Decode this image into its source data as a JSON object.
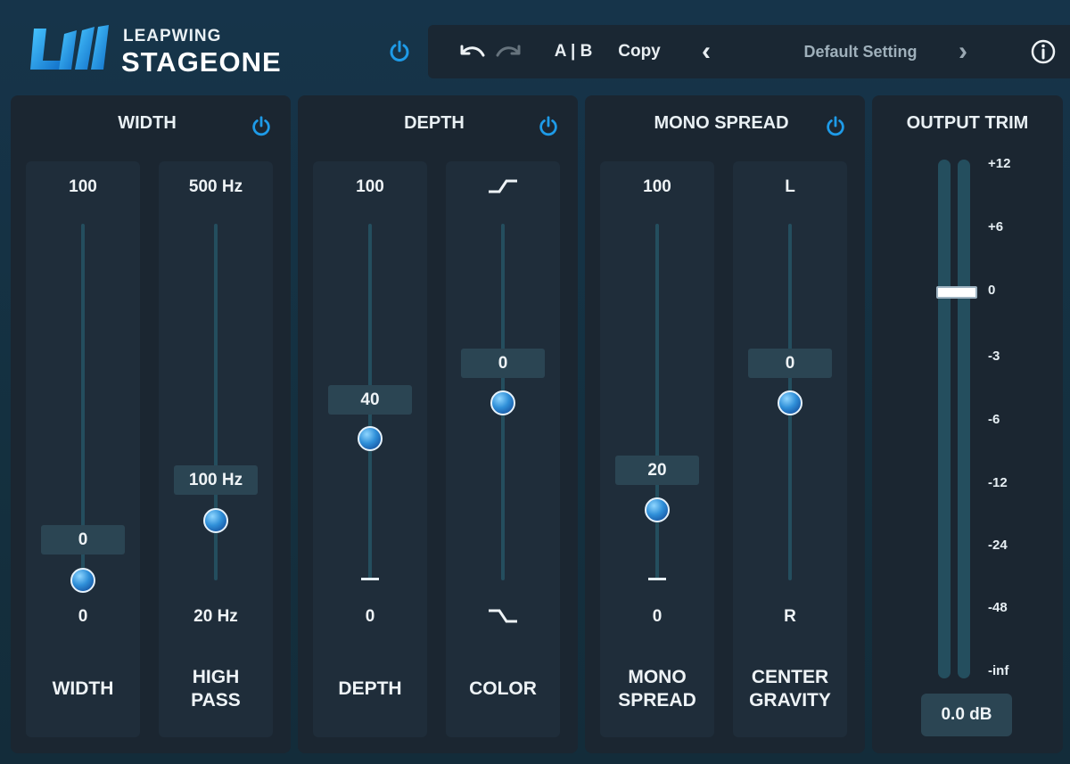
{
  "brand": {
    "top": "LEAPWING",
    "main": "STAGEONE"
  },
  "toolbar": {
    "ab": "A | B",
    "copy": "Copy",
    "prev": "‹",
    "preset": "Default Setting",
    "next": "›",
    "info": "i"
  },
  "panels": {
    "width": {
      "title": "WIDTH"
    },
    "depth": {
      "title": "DEPTH"
    },
    "mono": {
      "title": "MONO SPREAD"
    },
    "output": {
      "title": "OUTPUT TRIM"
    }
  },
  "sliders": {
    "width": {
      "top": "100",
      "bottom": "0",
      "value": "0",
      "name1": "WIDTH",
      "name2": "",
      "level": 0.0
    },
    "highpass": {
      "top": "500 Hz",
      "bottom": "20 Hz",
      "value": "100 Hz",
      "name1": "HIGH",
      "name2": "PASS",
      "level": 0.17
    },
    "depth": {
      "top": "100",
      "bottom": "0",
      "value": "40",
      "name1": "DEPTH",
      "name2": "",
      "level": 0.4
    },
    "color": {
      "top": "",
      "bottom": "",
      "value": "0",
      "name1": "COLOR",
      "name2": "",
      "level": 0.5
    },
    "monospread": {
      "top": "100",
      "bottom": "0",
      "value": "20",
      "name1": "MONO",
      "name2": "SPREAD",
      "level": 0.2
    },
    "gravity": {
      "top": "L",
      "bottom": "R",
      "value": "0",
      "name1": "CENTER",
      "name2": "GRAVITY",
      "level": 0.5
    }
  },
  "output": {
    "scale": [
      "+12",
      "+6",
      "0",
      "-3",
      "-6",
      "-12",
      "-24",
      "-48",
      "-inf"
    ],
    "value": "0.0 dB"
  },
  "colors": {
    "accent": "#1e9be8",
    "panel": "#1b2631",
    "track": "#244e5e"
  }
}
